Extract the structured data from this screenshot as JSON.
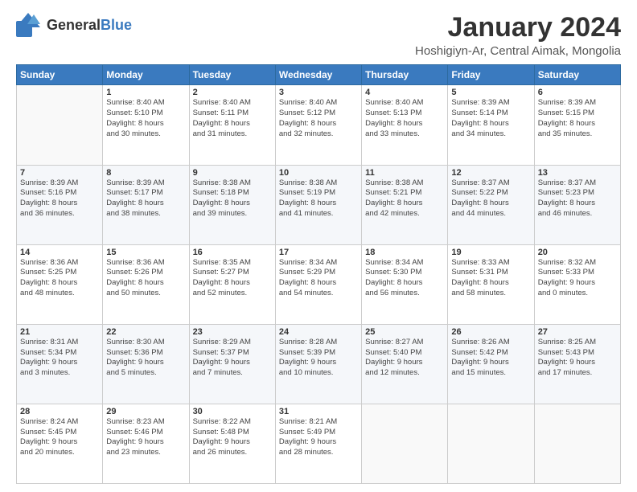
{
  "logo": {
    "text_general": "General",
    "text_blue": "Blue"
  },
  "header": {
    "title": "January 2024",
    "subtitle": "Hoshigiyn-Ar, Central Aimak, Mongolia"
  },
  "weekdays": [
    "Sunday",
    "Monday",
    "Tuesday",
    "Wednesday",
    "Thursday",
    "Friday",
    "Saturday"
  ],
  "weeks": [
    [
      {
        "day": "",
        "info": ""
      },
      {
        "day": "1",
        "info": "Sunrise: 8:40 AM\nSunset: 5:10 PM\nDaylight: 8 hours\nand 30 minutes."
      },
      {
        "day": "2",
        "info": "Sunrise: 8:40 AM\nSunset: 5:11 PM\nDaylight: 8 hours\nand 31 minutes."
      },
      {
        "day": "3",
        "info": "Sunrise: 8:40 AM\nSunset: 5:12 PM\nDaylight: 8 hours\nand 32 minutes."
      },
      {
        "day": "4",
        "info": "Sunrise: 8:40 AM\nSunset: 5:13 PM\nDaylight: 8 hours\nand 33 minutes."
      },
      {
        "day": "5",
        "info": "Sunrise: 8:39 AM\nSunset: 5:14 PM\nDaylight: 8 hours\nand 34 minutes."
      },
      {
        "day": "6",
        "info": "Sunrise: 8:39 AM\nSunset: 5:15 PM\nDaylight: 8 hours\nand 35 minutes."
      }
    ],
    [
      {
        "day": "7",
        "info": "Sunrise: 8:39 AM\nSunset: 5:16 PM\nDaylight: 8 hours\nand 36 minutes."
      },
      {
        "day": "8",
        "info": "Sunrise: 8:39 AM\nSunset: 5:17 PM\nDaylight: 8 hours\nand 38 minutes."
      },
      {
        "day": "9",
        "info": "Sunrise: 8:38 AM\nSunset: 5:18 PM\nDaylight: 8 hours\nand 39 minutes."
      },
      {
        "day": "10",
        "info": "Sunrise: 8:38 AM\nSunset: 5:19 PM\nDaylight: 8 hours\nand 41 minutes."
      },
      {
        "day": "11",
        "info": "Sunrise: 8:38 AM\nSunset: 5:21 PM\nDaylight: 8 hours\nand 42 minutes."
      },
      {
        "day": "12",
        "info": "Sunrise: 8:37 AM\nSunset: 5:22 PM\nDaylight: 8 hours\nand 44 minutes."
      },
      {
        "day": "13",
        "info": "Sunrise: 8:37 AM\nSunset: 5:23 PM\nDaylight: 8 hours\nand 46 minutes."
      }
    ],
    [
      {
        "day": "14",
        "info": "Sunrise: 8:36 AM\nSunset: 5:25 PM\nDaylight: 8 hours\nand 48 minutes."
      },
      {
        "day": "15",
        "info": "Sunrise: 8:36 AM\nSunset: 5:26 PM\nDaylight: 8 hours\nand 50 minutes."
      },
      {
        "day": "16",
        "info": "Sunrise: 8:35 AM\nSunset: 5:27 PM\nDaylight: 8 hours\nand 52 minutes."
      },
      {
        "day": "17",
        "info": "Sunrise: 8:34 AM\nSunset: 5:29 PM\nDaylight: 8 hours\nand 54 minutes."
      },
      {
        "day": "18",
        "info": "Sunrise: 8:34 AM\nSunset: 5:30 PM\nDaylight: 8 hours\nand 56 minutes."
      },
      {
        "day": "19",
        "info": "Sunrise: 8:33 AM\nSunset: 5:31 PM\nDaylight: 8 hours\nand 58 minutes."
      },
      {
        "day": "20",
        "info": "Sunrise: 8:32 AM\nSunset: 5:33 PM\nDaylight: 9 hours\nand 0 minutes."
      }
    ],
    [
      {
        "day": "21",
        "info": "Sunrise: 8:31 AM\nSunset: 5:34 PM\nDaylight: 9 hours\nand 3 minutes."
      },
      {
        "day": "22",
        "info": "Sunrise: 8:30 AM\nSunset: 5:36 PM\nDaylight: 9 hours\nand 5 minutes."
      },
      {
        "day": "23",
        "info": "Sunrise: 8:29 AM\nSunset: 5:37 PM\nDaylight: 9 hours\nand 7 minutes."
      },
      {
        "day": "24",
        "info": "Sunrise: 8:28 AM\nSunset: 5:39 PM\nDaylight: 9 hours\nand 10 minutes."
      },
      {
        "day": "25",
        "info": "Sunrise: 8:27 AM\nSunset: 5:40 PM\nDaylight: 9 hours\nand 12 minutes."
      },
      {
        "day": "26",
        "info": "Sunrise: 8:26 AM\nSunset: 5:42 PM\nDaylight: 9 hours\nand 15 minutes."
      },
      {
        "day": "27",
        "info": "Sunrise: 8:25 AM\nSunset: 5:43 PM\nDaylight: 9 hours\nand 17 minutes."
      }
    ],
    [
      {
        "day": "28",
        "info": "Sunrise: 8:24 AM\nSunset: 5:45 PM\nDaylight: 9 hours\nand 20 minutes."
      },
      {
        "day": "29",
        "info": "Sunrise: 8:23 AM\nSunset: 5:46 PM\nDaylight: 9 hours\nand 23 minutes."
      },
      {
        "day": "30",
        "info": "Sunrise: 8:22 AM\nSunset: 5:48 PM\nDaylight: 9 hours\nand 26 minutes."
      },
      {
        "day": "31",
        "info": "Sunrise: 8:21 AM\nSunset: 5:49 PM\nDaylight: 9 hours\nand 28 minutes."
      },
      {
        "day": "",
        "info": ""
      },
      {
        "day": "",
        "info": ""
      },
      {
        "day": "",
        "info": ""
      }
    ]
  ]
}
